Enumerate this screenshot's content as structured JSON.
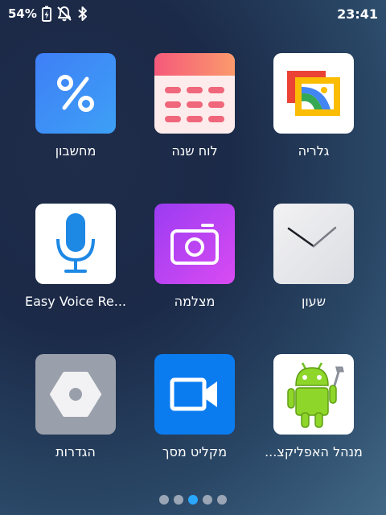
{
  "status_bar": {
    "battery_percent": "54%",
    "time": "23:41"
  },
  "apps": [
    {
      "label": "מחשבון",
      "icon": "calculator-icon",
      "color": "#3b82f6"
    },
    {
      "label": "לוח שנה",
      "icon": "calendar-icon",
      "color": "#f36a7a"
    },
    {
      "label": "גלריה",
      "icon": "gallery-icon",
      "color": "#ffffff"
    },
    {
      "label": "Easy Voice Re...",
      "icon": "microphone-icon",
      "color": "#ffffff"
    },
    {
      "label": "מצלמה",
      "icon": "camera-icon",
      "color": "#c13cf0"
    },
    {
      "label": "שעון",
      "icon": "clock-icon",
      "color": "#e9e9ec"
    },
    {
      "label": "הגדרות",
      "icon": "settings-icon",
      "color": "#9aa0ab"
    },
    {
      "label": "מקליט מסך",
      "icon": "screen-recorder-icon",
      "color": "#0a7cf0"
    },
    {
      "label": "...מנהל האפליקצ",
      "icon": "app-manager-android-icon",
      "color": "#ffffff"
    }
  ],
  "page_indicator": {
    "count": 5,
    "active_index": 2,
    "active_color": "#2aa7ff"
  }
}
